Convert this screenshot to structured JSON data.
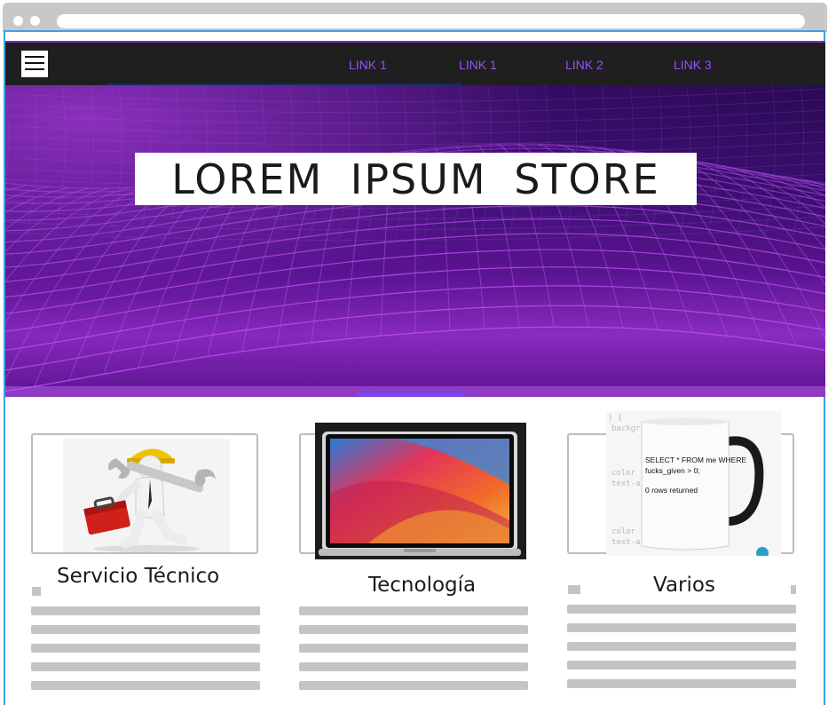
{
  "navbar": {
    "links": [
      "LINK 1",
      "LINK 1",
      "LINK 2",
      "LINK 3"
    ],
    "link_color": "#9b4dff",
    "background": "#1f1f1f"
  },
  "hero": {
    "title": "LOREM IPSUM STORE",
    "accent": "#b84cf0"
  },
  "cards": [
    {
      "title": "Servicio Técnico",
      "image": "technician-with-wrench-and-toolbox"
    },
    {
      "title": "Tecnología",
      "image": "laptop"
    },
    {
      "title": "Varios",
      "image": "coffee-mug-with-sql-text"
    }
  ],
  "mug": {
    "code_line_1": "SELECT * FROM me WHERE",
    "code_line_2": "fucks_given > 0;",
    "code_line_3": "0 rows returned"
  },
  "colors": {
    "frame_border": "#3ea0e8",
    "placeholder_gray": "#c4c4c4"
  }
}
